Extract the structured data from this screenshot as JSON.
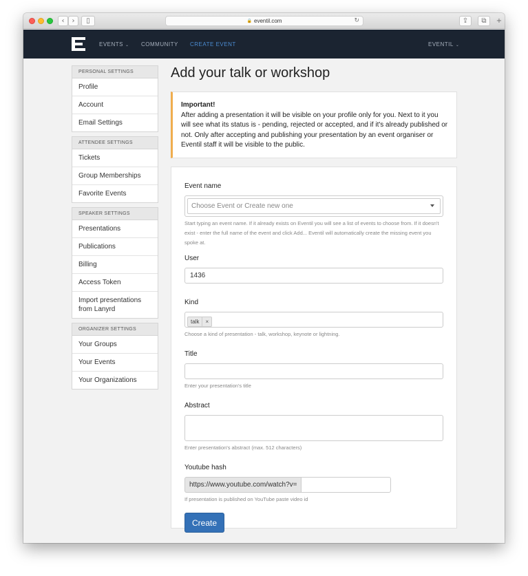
{
  "browser": {
    "url": "eventil.com",
    "back_glyph": "‹",
    "forward_glyph": "›",
    "sidebar_glyph": "▯",
    "reload_glyph": "↻",
    "share_glyph": "⇪",
    "tabs_glyph": "⧉",
    "newtab_glyph": "+"
  },
  "navbar": {
    "items": [
      {
        "label": "EVENTS",
        "has_chevron": true
      },
      {
        "label": "COMMUNITY",
        "has_chevron": false
      },
      {
        "label": "CREATE EVENT",
        "has_chevron": false,
        "active": true
      }
    ],
    "user_menu": "EVENTIL",
    "chevron_glyph": "⌄",
    "accent_color": "#4b8bd1",
    "bg_color": "#1b2431"
  },
  "sidebar": {
    "groups": [
      {
        "title": "PERSONAL SETTINGS",
        "items": [
          "Profile",
          "Account",
          "Email Settings"
        ]
      },
      {
        "title": "ATTENDEE SETTINGS",
        "items": [
          "Tickets",
          "Group Memberships",
          "Favorite Events"
        ]
      },
      {
        "title": "SPEAKER SETTINGS",
        "items": [
          "Presentations",
          "Publications",
          "Billing",
          "Access Token",
          "Import presentations from Lanyrd"
        ]
      },
      {
        "title": "ORGANIZER SETTINGS",
        "items": [
          "Your Groups",
          "Your Events",
          "Your Organizations"
        ]
      }
    ]
  },
  "main": {
    "title": "Add your talk or workshop",
    "alert": {
      "heading": "Important!",
      "body": "After adding a presentation it will be visible on your profile only for you. Next to it you will see what its status is - pending, rejected or accepted, and if it's already published or not. Only after accepting and publishing your presentation by an event organiser or Eventil staff it will be visible to the public.",
      "accent_color": "#f0ad4e"
    },
    "form": {
      "event_name": {
        "label": "Event name",
        "placeholder": "Choose Event or Create new one",
        "help": "Start typing an event name. If it already exists on Eventil you will see a list of events to choose from. If it doesn't exist - enter the full name of the event and click Add... Eventil will automatically create the missing event you spoke at."
      },
      "user": {
        "label": "User",
        "value": "1436"
      },
      "kind": {
        "label": "Kind",
        "tag": "talk",
        "tag_remove": "×",
        "help": "Choose a kind of presentation - talk, workshop, keynote or lightning."
      },
      "title": {
        "label": "Title",
        "value": "",
        "help": "Enter your presentation's title"
      },
      "abstract": {
        "label": "Abstract",
        "value": "",
        "help": "Enter presentation's abstract (max. 512 characters)"
      },
      "youtube": {
        "label": "Youtube hash",
        "prefix": "https://www.youtube.com/watch?v=",
        "value": "",
        "help": "If presentation is published on YouTube paste video id"
      },
      "submit_label": "Create",
      "submit_color": "#3471b7"
    }
  }
}
